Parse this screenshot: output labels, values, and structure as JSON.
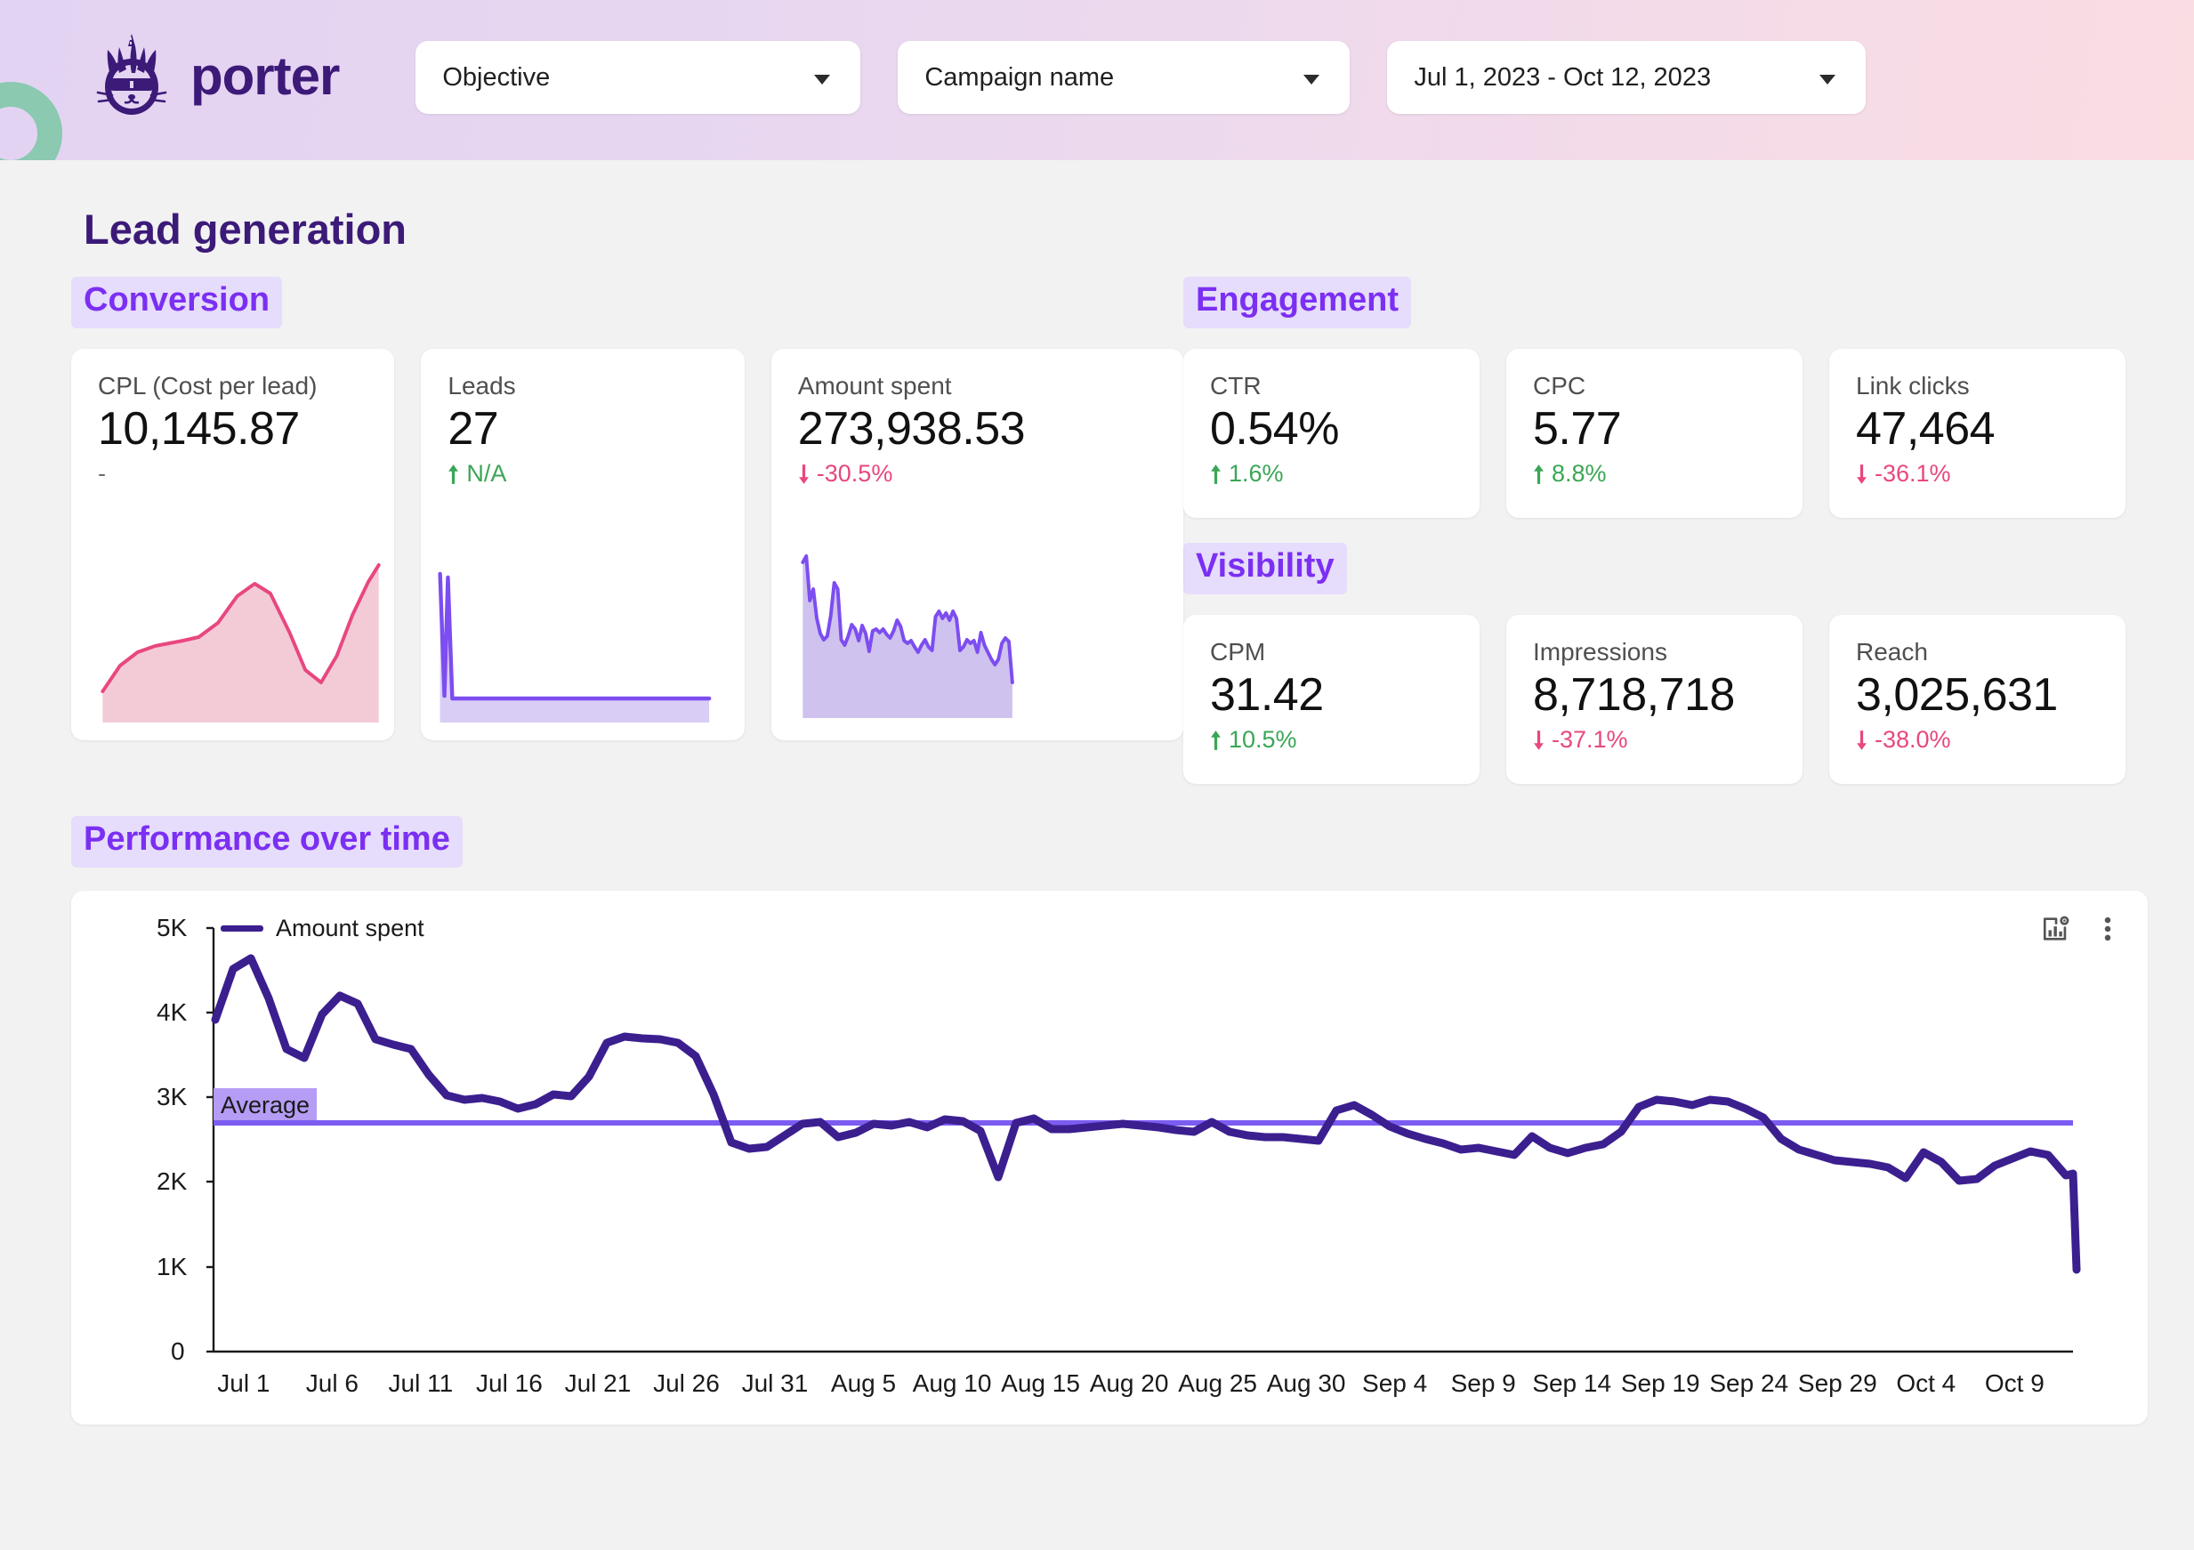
{
  "brand": {
    "name": "porter",
    "logo_icon": "unicorn-cat-logo",
    "accent": "#3c1a78"
  },
  "header": {
    "filters": [
      {
        "label": "Objective",
        "icon": "chevron-down-icon"
      },
      {
        "label": "Campaign name",
        "icon": "chevron-down-icon"
      },
      {
        "label": "Jul 1, 2023 - Oct 12, 2023",
        "icon": "chevron-down-icon"
      }
    ]
  },
  "page": {
    "title": "Lead generation"
  },
  "sections": {
    "conversion": {
      "title": "Conversion"
    },
    "engagement": {
      "title": "Engagement"
    },
    "visibility": {
      "title": "Visibility"
    },
    "performance": {
      "title": "Performance over time"
    }
  },
  "colors": {
    "positive": "#3aa655",
    "negative": "#e8477f",
    "line": "#3b1f8f",
    "average_line": "#7c5cf0",
    "spark_purple": "#7c4df0",
    "spark_pink": "#e8477f",
    "tag_bg": "#e6dcfb",
    "tag_text": "#7b2ff2"
  },
  "conversion_cards": [
    {
      "label": "CPL (Cost per lead)",
      "value": "10,145.87",
      "delta": "-",
      "direction": "none",
      "spark": "cpl-sparkline-pink"
    },
    {
      "label": "Leads",
      "value": "27",
      "delta": "N/A",
      "direction": "up",
      "spark": "leads-sparkline-purple"
    },
    {
      "label": "Amount spent",
      "value": "273,938.53",
      "delta": "-30.5%",
      "direction": "down",
      "spark": "amount-spent-sparkline-purple"
    }
  ],
  "engagement_cards": [
    {
      "label": "CTR",
      "value": "0.54%",
      "delta": "1.6%",
      "direction": "up"
    },
    {
      "label": "CPC",
      "value": "5.77",
      "delta": "8.8%",
      "direction": "up"
    },
    {
      "label": "Link clicks",
      "value": "47,464",
      "delta": "-36.1%",
      "direction": "down"
    }
  ],
  "visibility_cards": [
    {
      "label": "CPM",
      "value": "31.42",
      "delta": "10.5%",
      "direction": "up"
    },
    {
      "label": "Impressions",
      "value": "8,718,718",
      "delta": "-37.1%",
      "direction": "down"
    },
    {
      "label": "Reach",
      "value": "3,025,631",
      "delta": "-38.0%",
      "direction": "down"
    }
  ],
  "chart_tools": [
    {
      "name": "chart-settings-icon",
      "label": "Chart settings"
    },
    {
      "name": "more-options-icon",
      "label": "More options"
    }
  ],
  "chart_data": {
    "type": "line",
    "title": "Performance over time",
    "xlabel": "",
    "ylabel": "",
    "legend": [
      {
        "name": "Amount spent",
        "color": "#3b1f8f"
      }
    ],
    "legend_position": "top-left",
    "grid": false,
    "ylim": [
      0,
      5000
    ],
    "ytick_labels": [
      "0",
      "1K",
      "2K",
      "3K",
      "4K",
      "5K"
    ],
    "ytick_values": [
      0,
      1000,
      2000,
      3000,
      4000,
      5000
    ],
    "xtick_labels": [
      "Jul 1",
      "Jul 6",
      "Jul 11",
      "Jul 16",
      "Jul 21",
      "Jul 26",
      "Jul 31",
      "Aug 5",
      "Aug 10",
      "Aug 15",
      "Aug 20",
      "Aug 25",
      "Aug 30",
      "Sep 4",
      "Sep 9",
      "Sep 14",
      "Sep 19",
      "Sep 24",
      "Sep 29",
      "Oct 4",
      "Oct 9"
    ],
    "annotations": [
      {
        "label": "Average",
        "type": "hline",
        "value": 2690,
        "color": "#7c5cf0"
      }
    ],
    "series": [
      {
        "name": "Amount spent",
        "x": [
          "Jul 1",
          "Jul 2",
          "Jul 3",
          "Jul 4",
          "Jul 5",
          "Jul 6",
          "Jul 7",
          "Jul 8",
          "Jul 9",
          "Jul 10",
          "Jul 11",
          "Jul 12",
          "Jul 13",
          "Jul 14",
          "Jul 15",
          "Jul 16",
          "Jul 17",
          "Jul 18",
          "Jul 19",
          "Jul 20",
          "Jul 21",
          "Jul 22",
          "Jul 23",
          "Jul 24",
          "Jul 25",
          "Jul 26",
          "Jul 27",
          "Jul 28",
          "Jul 29",
          "Jul 30",
          "Jul 31",
          "Aug 1",
          "Aug 2",
          "Aug 3",
          "Aug 4",
          "Aug 5",
          "Aug 6",
          "Aug 7",
          "Aug 8",
          "Aug 9",
          "Aug 10",
          "Aug 11",
          "Aug 12",
          "Aug 13",
          "Aug 14",
          "Aug 15",
          "Aug 16",
          "Aug 17",
          "Aug 18",
          "Aug 19",
          "Aug 20",
          "Aug 21",
          "Aug 22",
          "Aug 23",
          "Aug 24",
          "Aug 25",
          "Aug 26",
          "Aug 27",
          "Aug 28",
          "Aug 29",
          "Aug 30",
          "Aug 31",
          "Sep 1",
          "Sep 2",
          "Sep 3",
          "Sep 4",
          "Sep 5",
          "Sep 6",
          "Sep 7",
          "Sep 8",
          "Sep 9",
          "Sep 10",
          "Sep 11",
          "Sep 12",
          "Sep 13",
          "Sep 14",
          "Sep 15",
          "Sep 16",
          "Sep 17",
          "Sep 18",
          "Sep 19",
          "Sep 20",
          "Sep 21",
          "Sep 22",
          "Sep 23",
          "Sep 24",
          "Sep 25",
          "Sep 26",
          "Sep 27",
          "Sep 28",
          "Sep 29",
          "Sep 30",
          "Oct 1",
          "Oct 2",
          "Oct 3",
          "Oct 4",
          "Oct 5",
          "Oct 6",
          "Oct 7",
          "Oct 8",
          "Oct 9",
          "Oct 10",
          "Oct 11",
          "Oct 12"
        ],
        "values": [
          3920,
          4520,
          4650,
          4180,
          3580,
          3480,
          4000,
          4220,
          4120,
          3700,
          3640,
          3580,
          3280,
          3040,
          2980,
          3000,
          2960,
          2870,
          2920,
          3040,
          3020,
          3260,
          3660,
          3740,
          3720,
          3700,
          3660,
          3500,
          3050,
          2480,
          2400,
          2430,
          2560,
          2700,
          2720,
          2540,
          2600,
          2700,
          2680,
          2720,
          2660,
          2760,
          2740,
          2620,
          2080,
          2700,
          2760,
          2640,
          2640,
          2660,
          2680,
          2700,
          2680,
          2660,
          2640,
          2620,
          2740,
          2620,
          2580,
          2560,
          2560,
          2540,
          2520,
          2880,
          2940,
          2820,
          2680,
          2600,
          2540,
          2480,
          2400,
          2420,
          2380,
          2340,
          2560,
          2420,
          2360,
          2420,
          2460,
          2600,
          2880,
          2960,
          2940,
          2900,
          2960,
          2940,
          2860,
          2760,
          2540,
          2420,
          2360,
          2300,
          2280,
          2260,
          2220,
          2100,
          2400,
          2280,
          2060,
          2080,
          2240,
          2320,
          2400,
          2360,
          2120,
          2140,
          980
        ]
      }
    ]
  },
  "sparklines": {
    "cpl": {
      "values": [
        10,
        24,
        34,
        40,
        43,
        45,
        48,
        58,
        78,
        88,
        80,
        55,
        28,
        16,
        35,
        62,
        88,
        100
      ],
      "color": "#e8477f",
      "fill": "#f3cbd6"
    },
    "leads": {
      "values": [
        100,
        6,
        96,
        2,
        2,
        2,
        2,
        2,
        2,
        2,
        2,
        2,
        2,
        2,
        2,
        2,
        2,
        2,
        2,
        2,
        2,
        2
      ],
      "color": "#7c4df0",
      "fill": "#d9cdf6"
    },
    "amount": {
      "values": [
        88,
        100,
        70,
        80,
        62,
        46,
        40,
        42,
        56,
        82,
        78,
        40,
        36,
        44,
        54,
        50,
        40,
        54,
        46,
        32,
        48,
        50,
        48,
        50,
        46,
        44,
        50,
        60,
        52,
        40,
        38,
        40,
        34,
        30,
        36,
        40,
        34,
        32,
        62,
        66,
        60,
        64,
        58,
        66,
        60,
        32,
        36,
        42,
        38,
        40,
        30,
        46,
        36,
        30,
        24,
        20,
        24,
        38,
        42,
        40,
        10
      ],
      "color": "#7c4df0",
      "fill": "#cfc2ee"
    }
  }
}
